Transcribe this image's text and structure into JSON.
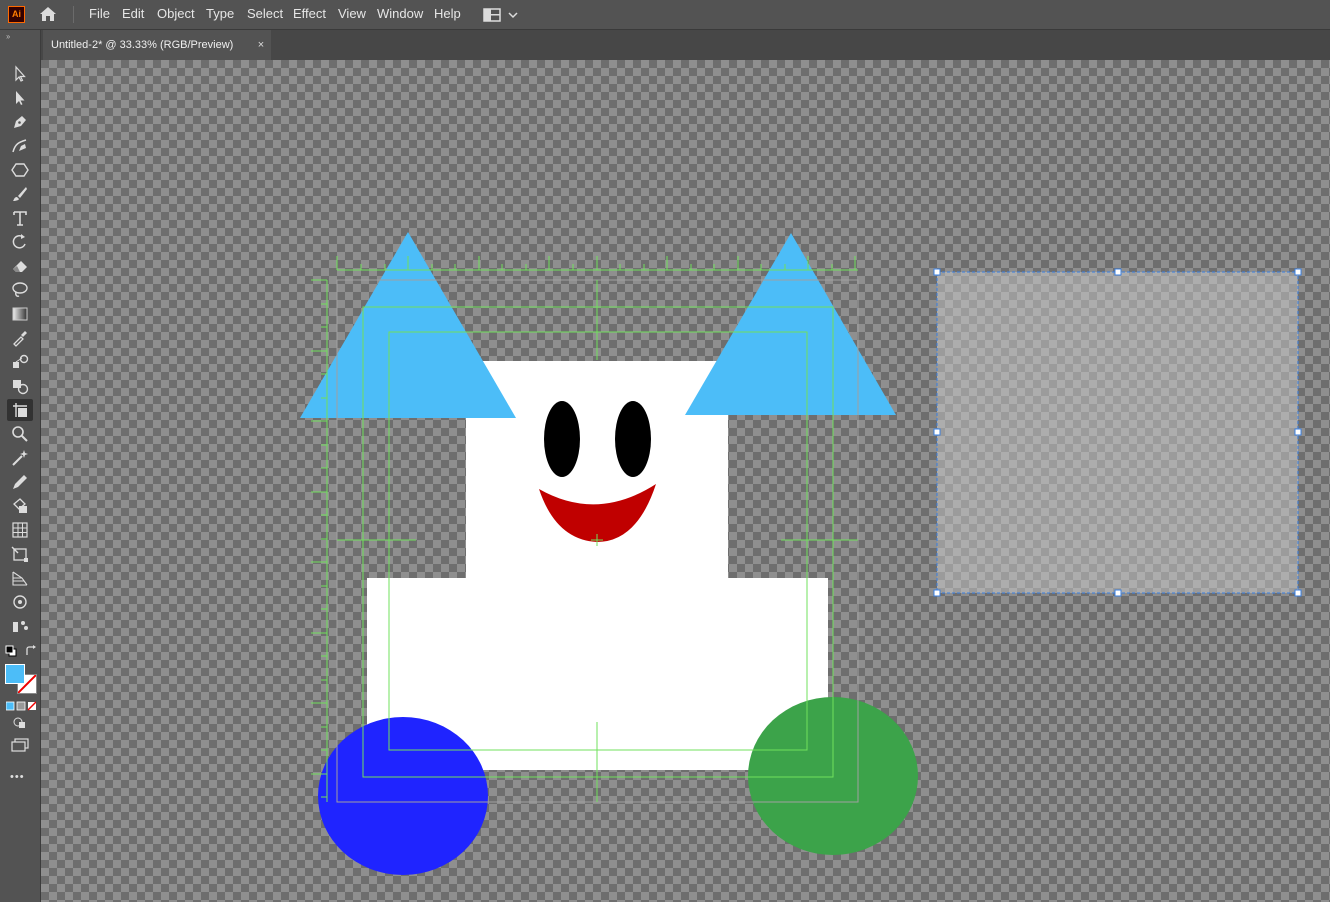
{
  "app": {
    "logo_text": "Ai"
  },
  "menu": [
    "File",
    "Edit",
    "Object",
    "Type",
    "Select",
    "Effect",
    "View",
    "Window",
    "Help"
  ],
  "document_tab": {
    "title": "Untitled-2* @ 33.33% (RGB/Preview)",
    "close_glyph": "×"
  },
  "toolbar": {
    "grip": "››",
    "tools": [
      "selection-tool",
      "direct-selection-tool",
      "pen-tool",
      "curvature-tool",
      "polygon-tool",
      "paintbrush-tool",
      "type-tool",
      "rotate-tool",
      "eraser-tool",
      "lasso-tool",
      "gradient-tool",
      "eyedropper-tool",
      "blend-tool",
      "shape-builder-tool",
      "artboard-tool",
      "zoom-tool",
      "magic-wand-tool",
      "pencil-tool",
      "live-paint-tool",
      "mesh-tool",
      "free-transform-tool",
      "perspective-grid-tool",
      "puppet-warp-tool",
      "symbol-sprayer-tool"
    ],
    "active_tool": "artboard-tool",
    "more_glyph": "•••"
  },
  "colors": {
    "fill": "#4cbdf8",
    "ear": "#4cbdf8",
    "mouth": "#c00000",
    "left_wheel": "#1f24ff",
    "right_wheel": "#3ca34a",
    "guides": "#70e05c",
    "selection": "#4a90e2"
  }
}
